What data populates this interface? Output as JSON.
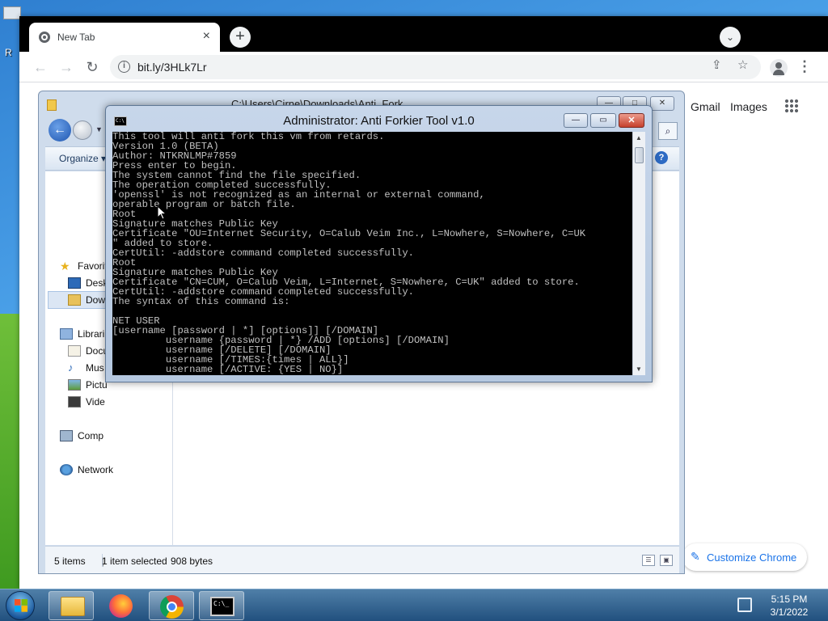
{
  "desktop": {
    "label_fragment": "R"
  },
  "browser": {
    "tab_title": "New Tab",
    "tab_close": "×",
    "new_tab": "+",
    "url": "bit.ly/3HLk7Lr",
    "gmail": "Gmail",
    "images": "Images",
    "customize": "Customize Chrome"
  },
  "explorer": {
    "title": "C:\\Users\\Cirne\\Downloads\\Anti_Fork",
    "organize": "Organize ▾",
    "nav": {
      "favorites": "Favorit",
      "desktop": "Desk",
      "downloads": "Dow",
      "libraries": "Librari",
      "documents": "Docu",
      "music": "Mus",
      "pictures": "Pictu",
      "videos": "Vide",
      "computer": "Comp",
      "network": "Network"
    },
    "status": {
      "items": "5 items",
      "selected": "1 item selected",
      "size": "908 bytes"
    }
  },
  "cmd": {
    "title": "Administrator:  Anti Forkier Tool v1.0",
    "lines": [
      "This tool will anti fork this vm from retards.",
      "Version 1.0 (BETA)",
      "Author: NTKRNLMP#7859",
      "Press enter to begin.",
      "The system cannot find the file specified.",
      "The operation completed successfully.",
      "'openssl' is not recognized as an internal or external command,",
      "operable program or batch file.",
      "Root",
      "Signature matches Public Key",
      "Certificate \"OU=Internet Security, O=Calub Veim Inc., L=Nowhere, S=Nowhere, C=UK",
      "\" added to store.",
      "CertUtil: -addstore command completed successfully.",
      "Root",
      "Signature matches Public Key",
      "Certificate \"CN=CUM, O=Calub Veim, L=Internet, S=Nowhere, C=UK\" added to store.",
      "CertUtil: -addstore command completed successfully.",
      "The syntax of this command is:",
      "",
      "NET USER",
      "[username [password | *] [options]] [/DOMAIN]",
      "         username {password | *} /ADD [options] [/DOMAIN]",
      "         username [/DELETE] [/DOMAIN]",
      "         username [/TIMES:{times | ALL}]",
      "         username [/ACTIVE: {YES | NO}]"
    ]
  },
  "taskbar": {
    "time": "5:15 PM",
    "date": "3/1/2022"
  }
}
